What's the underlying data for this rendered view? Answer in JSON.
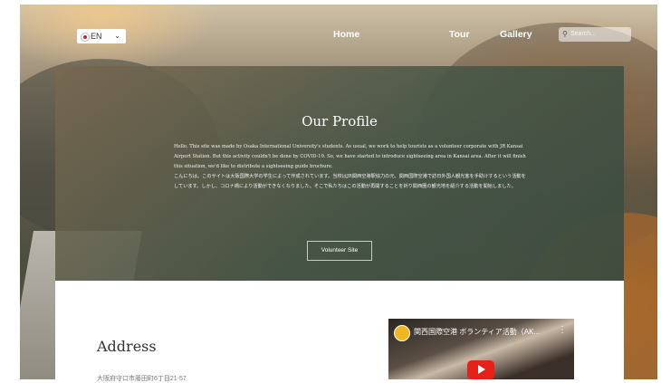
{
  "nav": {
    "language": "EN",
    "links": [
      "Home",
      "Tour",
      "Gallery"
    ],
    "search_placeholder": "Search..."
  },
  "profile": {
    "title": "Our Profile",
    "text_en": "Hello. This site was made by Osaka International University's students. As usual, we work to help tourists as a volunteer corporate with JR Kansai Airport Station. But this activity couldn't be done by COVID-19. So, we have started to introduce sightseeing area in Kansai area. After it will finish this situation, we'd like to distribute a sightseeing guide brochure.",
    "text_ja": "こんにちは。このサイトは大阪国際大学の学生によって作成されています。当校はJR関西空港駅協力の元、関西国際空港で訪日外国人観光客を手助けするという活動をしています。しかし、コロナ禍により活動ができなくなりました。そこで私たちはこの活動が再開することを祈り関西圏の観光地を紹介する活動を開始しました。",
    "button": "Volunteer Site"
  },
  "address": {
    "title": "Address",
    "line": "大阪府守口市藤田町6丁目21-57"
  },
  "video": {
    "title": "関西国際空港 ボランティア活動（AK..."
  },
  "colors": {
    "youtube_red": "#e62117",
    "profile_panel": "#4a5a4c"
  }
}
